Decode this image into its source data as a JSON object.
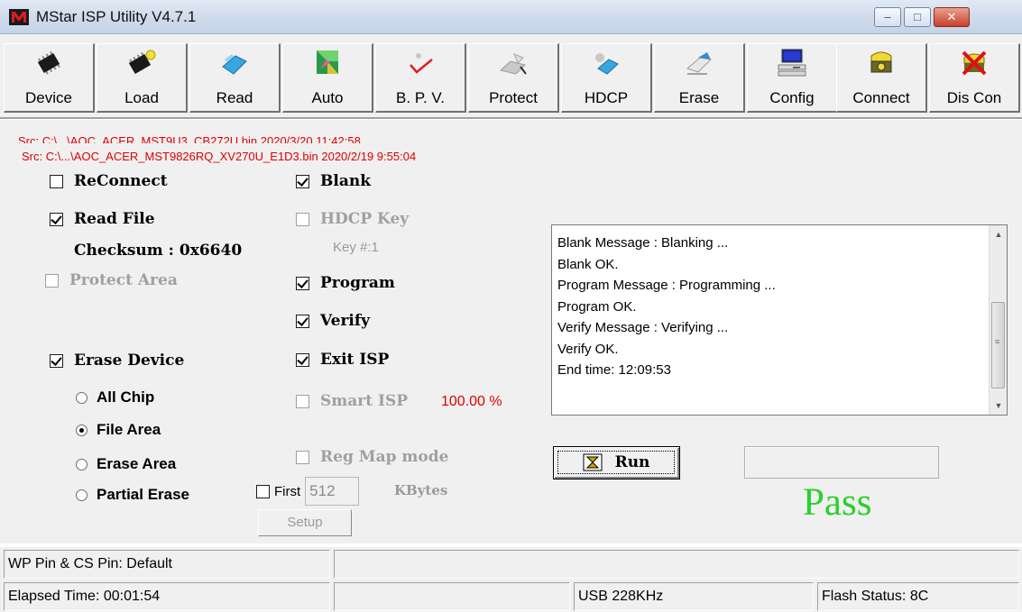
{
  "window": {
    "title": "MStar ISP Utility V4.7.1",
    "minimize_glyph": "–",
    "maximize_glyph": "□",
    "close_glyph": "✕"
  },
  "toolbar": {
    "buttons": [
      {
        "label": "Device",
        "icon": "chip-icon"
      },
      {
        "label": "Load",
        "icon": "chip-load-icon"
      },
      {
        "label": "Read",
        "icon": "read-icon"
      },
      {
        "label": "Auto",
        "icon": "auto-icon"
      },
      {
        "label": "B. P. V.",
        "icon": "checkmark-icon"
      },
      {
        "label": "Protect",
        "icon": "protect-icon"
      },
      {
        "label": "HDCP",
        "icon": "hdcp-icon"
      },
      {
        "label": "Erase",
        "icon": "eraser-icon"
      },
      {
        "label": "Config",
        "icon": "computer-icon"
      },
      {
        "label": "Connect",
        "icon": "connect-icon"
      },
      {
        "label": "Dis Con",
        "icon": "disconnect-icon"
      }
    ]
  },
  "sources": {
    "line1": "Src: C:\\...\\AOC_ACER_MST9U3_CB272U.bin 2020/3/20 11:42:58",
    "line2": "Src: C:\\...\\AOC_ACER_MST9826RQ_XV270U_E1D3.bin 2020/2/19 9:55:04"
  },
  "options": {
    "reconnect": {
      "label": "ReConnect",
      "checked": false
    },
    "read_file": {
      "label": "Read File",
      "checked": true
    },
    "checksum": "Checksum : 0x6640",
    "protect_area": {
      "label": "Protect Area",
      "checked": false
    },
    "erase_device": {
      "label": "Erase Device",
      "checked": true
    },
    "blank": {
      "label": "Blank",
      "checked": true
    },
    "hdcp_key": {
      "label": "HDCP Key",
      "checked": false
    },
    "key_num": "Key #:1",
    "program": {
      "label": "Program",
      "checked": true
    },
    "verify": {
      "label": "Verify",
      "checked": true
    },
    "exit_isp": {
      "label": "Exit ISP",
      "checked": true
    },
    "smart_isp": {
      "label": "Smart ISP",
      "checked": false
    },
    "smart_isp_percent": "100.00 %",
    "reg_map_mode": {
      "label": "Reg Map mode",
      "checked": false
    },
    "first": {
      "label": "First",
      "checked": false,
      "value": "512"
    },
    "kbytes": "KBytes",
    "setup_label": "Setup"
  },
  "erase_modes": [
    {
      "label": "All Chip",
      "selected": false
    },
    {
      "label": "File Area",
      "selected": true
    },
    {
      "label": "Erase Area",
      "selected": false
    },
    {
      "label": "Partial Erase",
      "selected": false
    }
  ],
  "log": [
    "Blank Message : Blanking ...",
    "Blank OK.",
    "Program Message : Programming ...",
    "Program OK.",
    "Verify Message : Verifying ...",
    "Verify OK.",
    "End time: 12:09:53"
  ],
  "run": {
    "label": "Run"
  },
  "result": "Pass",
  "status": {
    "wp_cs": "WP Pin & CS Pin: Default",
    "elapsed": "Elapsed Time: 00:01:54",
    "usb": "USB  228KHz",
    "flash": "Flash Status: 8C"
  },
  "colors": {
    "source_text": "#e00000",
    "pass_text": "#2bd02b",
    "panel_bg": "#f0f0f0"
  }
}
